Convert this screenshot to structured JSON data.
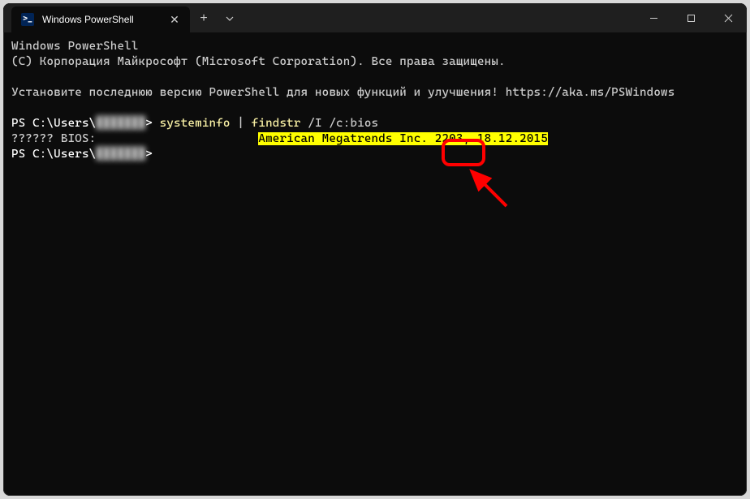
{
  "tab": {
    "title": "Windows PowerShell"
  },
  "header": {
    "line1": "Windows PowerShell",
    "line2": "(C) Корпорация Майкрософт (Microsoft Corporation). Все права защищены.",
    "install_msg": "Установите последнюю версию PowerShell для новых функций и улучшения! https://aka.ms/PSWindows"
  },
  "prompt": {
    "prefix": "PS C:\\Users\\",
    "user_obscured": "███████",
    "suffix": "> "
  },
  "command": {
    "cmd1": "systeminfo",
    "pipe": " | ",
    "cmd2": "findstr",
    "args": " /I /c:bios"
  },
  "output": {
    "label": "?????? BIOS:",
    "gap": "                       ",
    "vendor": "American Megatrends Inc. ",
    "version": "2203,",
    "space": " ",
    "date": "18.12.2015"
  }
}
